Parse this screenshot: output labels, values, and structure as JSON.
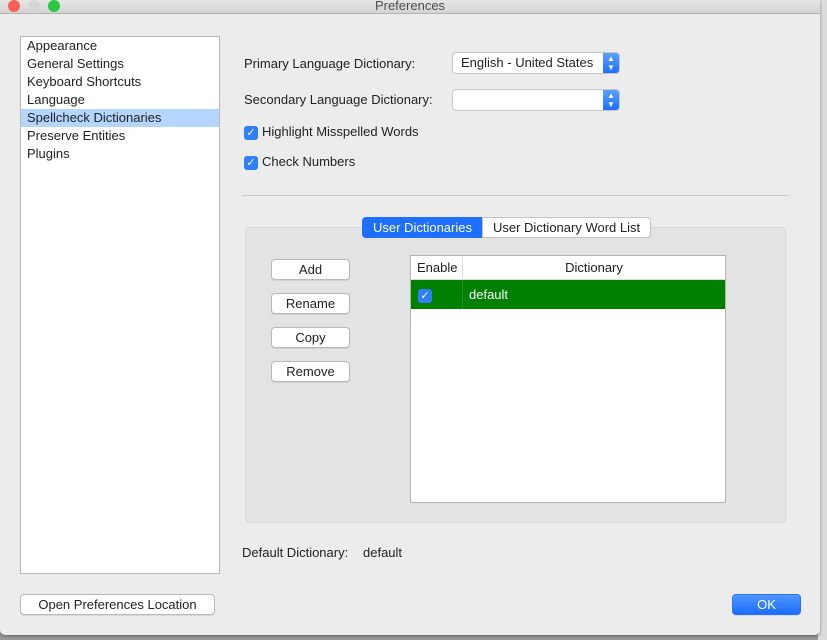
{
  "window": {
    "title": "Preferences"
  },
  "sidebar": {
    "items": [
      {
        "label": "Appearance"
      },
      {
        "label": "General Settings"
      },
      {
        "label": "Keyboard Shortcuts"
      },
      {
        "label": "Language"
      },
      {
        "label": "Spellcheck Dictionaries",
        "selected": true
      },
      {
        "label": "Preserve Entities"
      },
      {
        "label": "Plugins"
      }
    ]
  },
  "settings": {
    "primary_label": "Primary Language Dictionary:",
    "primary_value": "English - United States",
    "secondary_label": "Secondary Language Dictionary:",
    "secondary_value": "",
    "highlight_label": "Highlight Misspelled Words",
    "highlight_checked": true,
    "numbers_label": "Check Numbers",
    "numbers_checked": true
  },
  "tabs": [
    {
      "label": "User Dictionaries",
      "active": true
    },
    {
      "label": "User Dictionary Word List",
      "active": false
    }
  ],
  "buttons": {
    "add": "Add",
    "rename": "Rename",
    "copy": "Copy",
    "remove": "Remove",
    "open_location": "Open Preferences Location",
    "ok": "OK"
  },
  "table": {
    "headers": [
      "Enable",
      "Dictionary"
    ],
    "rows": [
      {
        "enabled": true,
        "check": "✓",
        "name": "default"
      }
    ]
  },
  "default_dictionary": {
    "label": "Default Dictionary:",
    "value": "default"
  },
  "colors": {
    "accent": "#1e6fff",
    "selected_row": "#008000",
    "sidebar_selection": "#b4d5fe"
  }
}
